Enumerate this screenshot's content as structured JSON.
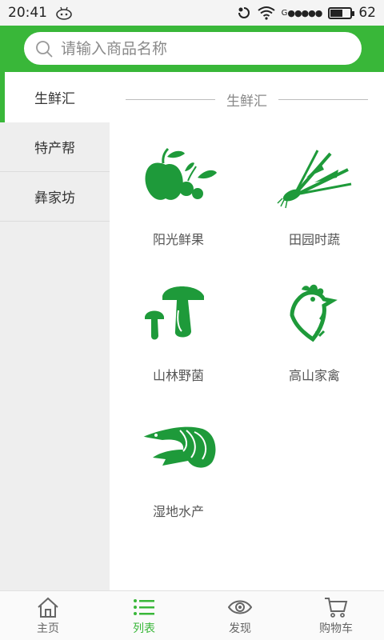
{
  "status_bar": {
    "time": "20:41",
    "network_label": "G",
    "signal_dots": "●●●●●",
    "battery_level": "62",
    "battery_fraction": 0.62
  },
  "search": {
    "placeholder": "请输入商品名称",
    "icon": "search-icon"
  },
  "sidebar": {
    "items": [
      {
        "label": "生鲜汇",
        "active": true
      },
      {
        "label": "特产帮",
        "active": false
      },
      {
        "label": "彝家坊",
        "active": false
      }
    ]
  },
  "content": {
    "section_title": "生鲜汇",
    "categories": [
      {
        "label": "阳光鲜果",
        "icon": "fruit-icon"
      },
      {
        "label": "田园时蔬",
        "icon": "vegetable-icon"
      },
      {
        "label": "山林野菌",
        "icon": "mushroom-icon"
      },
      {
        "label": "高山家禽",
        "icon": "chicken-icon"
      },
      {
        "label": "湿地水产",
        "icon": "shrimp-icon"
      }
    ]
  },
  "bottom_nav": {
    "items": [
      {
        "label": "主页",
        "icon": "home-icon",
        "active": false
      },
      {
        "label": "列表",
        "icon": "list-icon",
        "active": true
      },
      {
        "label": "发现",
        "icon": "eye-icon",
        "active": false
      },
      {
        "label": "购物车",
        "icon": "cart-icon",
        "active": false
      }
    ]
  },
  "colors": {
    "accent": "#39b739",
    "icon_green": "#1e9a3a"
  }
}
